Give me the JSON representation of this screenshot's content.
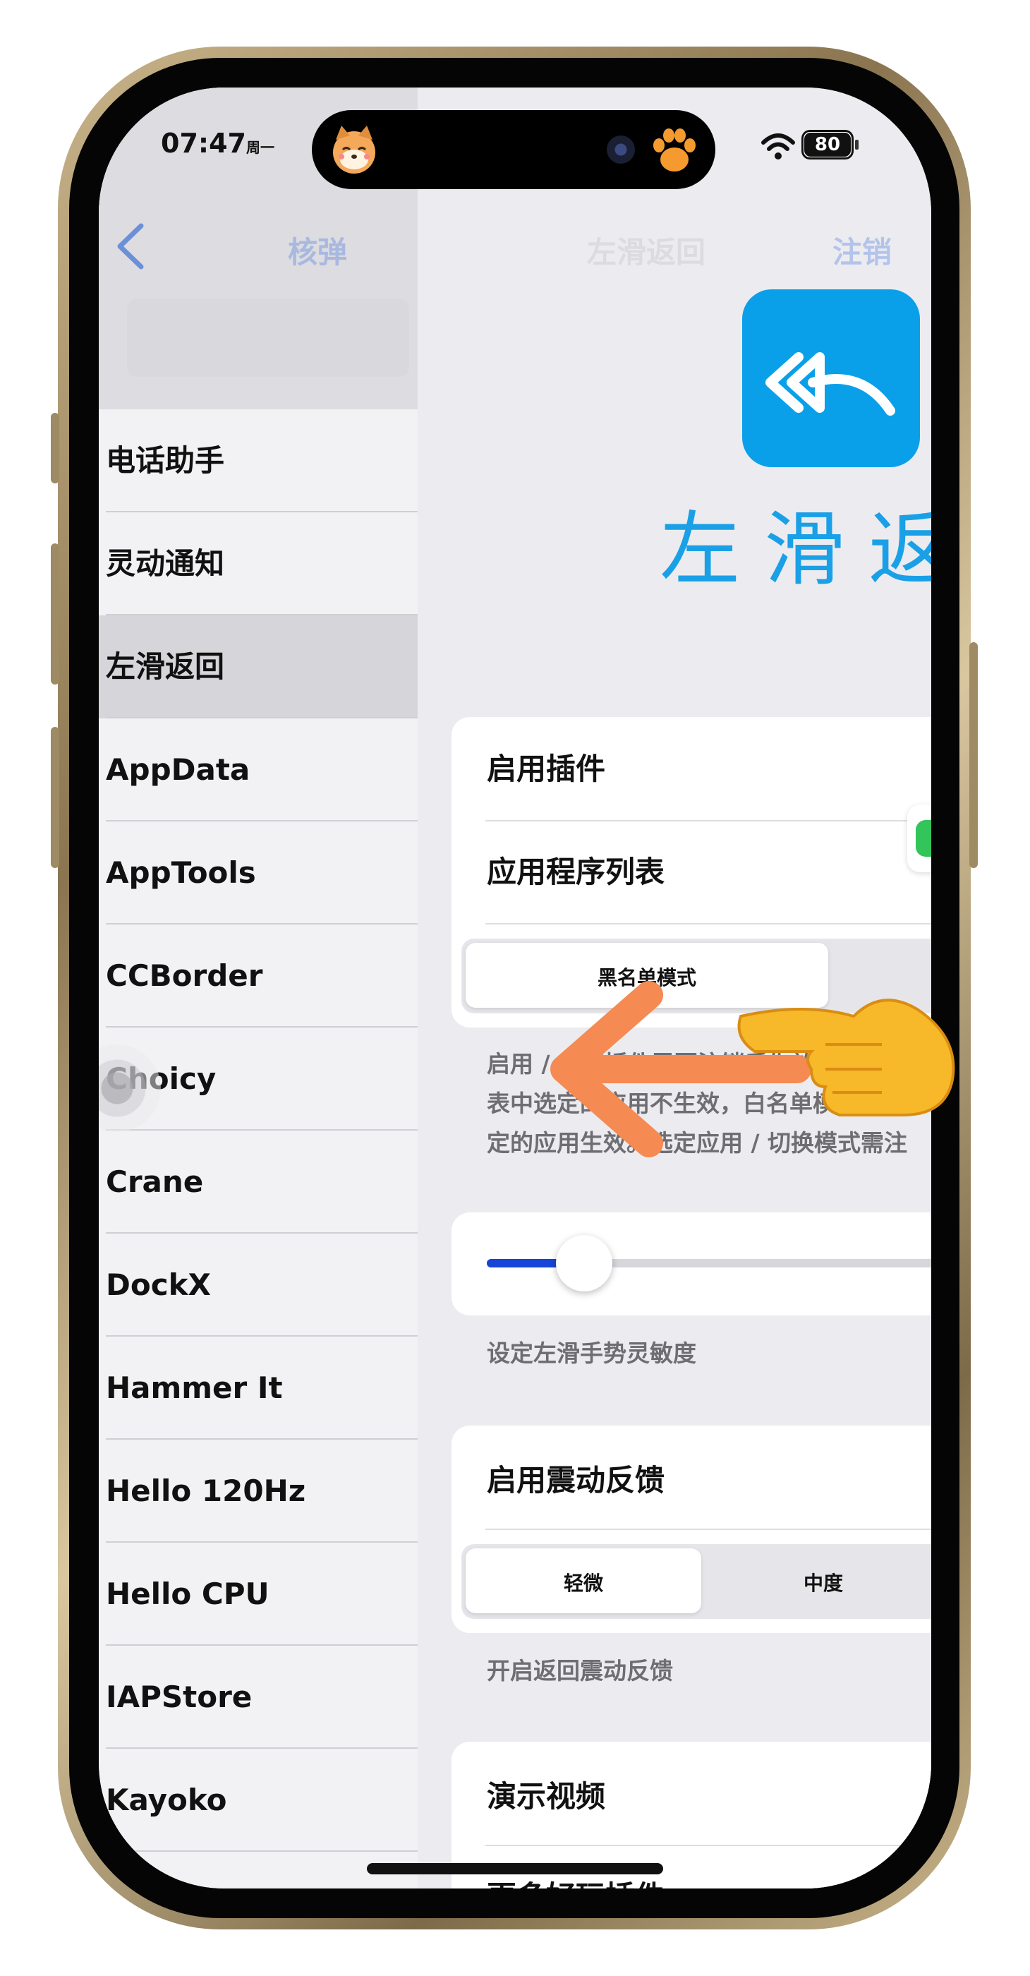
{
  "status_bar": {
    "time": "07:47",
    "weekday": "周一",
    "battery": "80"
  },
  "nav": {
    "back_label": "<",
    "left_title": "核弹",
    "center_title": "左滑返回",
    "right_action": "注销"
  },
  "sidebar": {
    "items": [
      {
        "label": "电话助手"
      },
      {
        "label": "灵动通知"
      },
      {
        "label": "左滑返回",
        "selected": true
      },
      {
        "label": "AppData"
      },
      {
        "label": "AppTools"
      },
      {
        "label": "CCBorder"
      },
      {
        "label": "Choicy"
      },
      {
        "label": "Crane"
      },
      {
        "label": "DockX"
      },
      {
        "label": "Hammer It"
      },
      {
        "label": "Hello 120Hz"
      },
      {
        "label": "Hello CPU"
      },
      {
        "label": "IAPStore"
      },
      {
        "label": "Kayoko"
      }
    ]
  },
  "plugin": {
    "banner_title": "左滑返",
    "icon_name": "double-reply-arrow-icon",
    "brand_color": "#0aa0e9"
  },
  "settings": {
    "enable_label": "启用插件",
    "app_list_label": "应用程序列表",
    "mode_selected": "黑名单模式",
    "mode_note_lines": [
      "启用 / 关闭插件需要注销后生效",
      "表中选定的应用不生效，白名单模式",
      "定的应用生效。选定应用 / 切换模式需注"
    ],
    "sensitivity_value": 0.2,
    "sensitivity_note": "设定左滑手势灵敏度",
    "haptic_label": "启用震动反馈",
    "haptic_options": [
      "轻微",
      "中度"
    ],
    "haptic_selected": "轻微",
    "haptic_note": "开启返回震动反馈",
    "demo_label": "演示视频",
    "more_label": "更多好玩插件"
  },
  "colors": {
    "accent": "#1745d8",
    "arrow": "#f58a52",
    "nav_tint": "#6b8fd9"
  }
}
